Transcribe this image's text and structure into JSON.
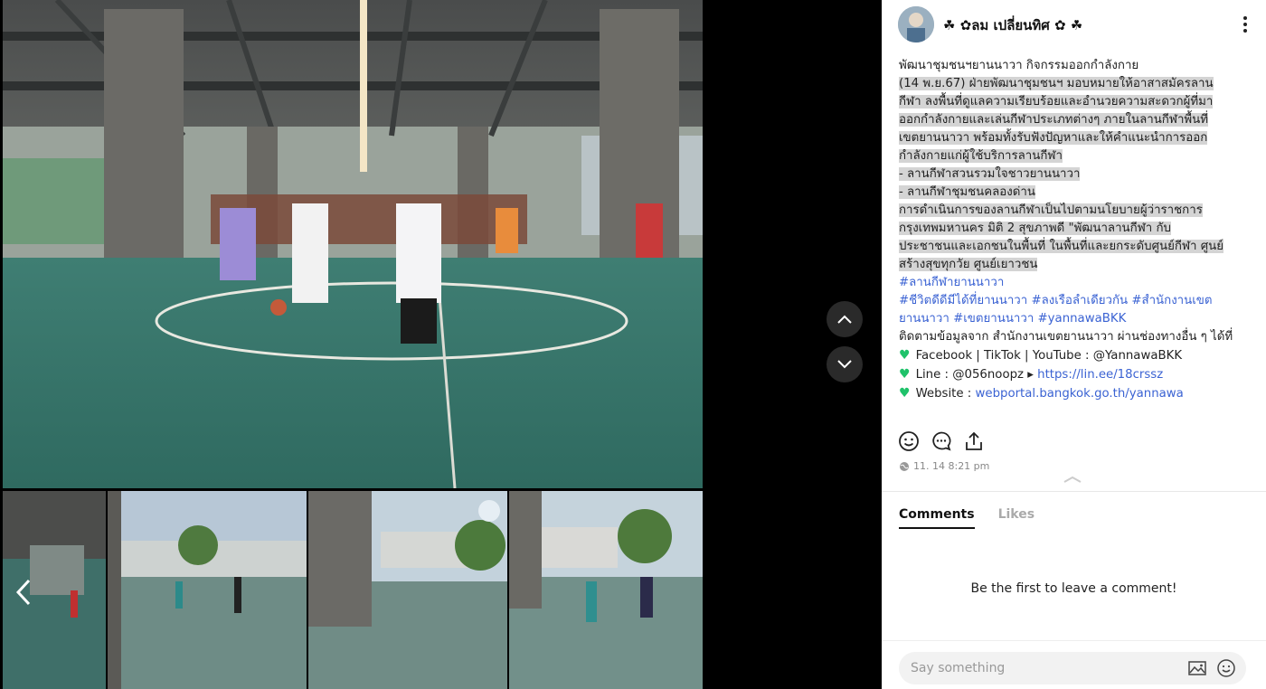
{
  "author": {
    "name": "☘ ✿ลม เปลี่ยนทิศ ✿ ☘"
  },
  "post": {
    "title": "พัฒนาชุมชนฯยานนาวา กิจกรรมออกกำลังกาย",
    "lines": [
      " (14 พ.ย.67)  ฝ่ายพัฒนาชุมชนฯ มอบหมายให้อาสาสมัครลาน",
      "กีฬา ลงพื้นที่ดูแลความเรียบร้อยและอำนวยความสะดวกผู้ที่มา",
      "ออกกำลังกายและเล่นกีฬาประเภทต่างๆ ภายในลานกีฬาพื้นที่",
      "เขตยานนาวา พร้อมทั้งรับฟังปัญหาและให้คำแนะนำการออก",
      "กำลังกายแก่ผู้ใช้บริการลานกีฬา",
      "- ลานกีฬาสวนรวมใจชาวยานนาวา",
      "- ลานกีฬาชุมชนคลองด่าน",
      "   การดำเนินการของลานกีฬาเป็นไปตามนโยบายผู้ว่าราชการ",
      "กรุงเทพมหานคร  มิติ 2 สุขภาพดี  \"พัฒนาลานกีฬา กับ",
      "ประชาชนและเอกชนในพื้นที่ ในพื้นที่และยกระดับศูนย์กีฬา ศูนย์",
      "สร้างสุขทุกวัย ศูนย์เยาวชน"
    ],
    "hashtag_1": "#ลานกีฬายานนาวา",
    "hashtag_2": "#ชีวิตดีดีมีได้ที่ยานนาวา #ลงเรือลำเดียวกัน #สำนักงานเขตยานนาวา #เขตยานนาวา #yannawaBKK",
    "follow": "ติดตามข้อมูลจาก สำนักงานเขตยานนาวา ผ่านช่องทางอื่น ๆ ได้ที่",
    "contact_1": "Facebook | TikTok | YouTube : @YannawaBKK",
    "contact_2_label": "Line : @056noopz ▸ ",
    "contact_2_link": "https://lin.ee/18crssz",
    "contact_3_label": "Website : ",
    "contact_3_link": "webportal.bangkok.go.th/yannawa",
    "timestamp": "11. 14 8:21 pm"
  },
  "tabs": {
    "comments": "Comments",
    "likes": "Likes"
  },
  "empty_comments": "Be the first to leave a comment!",
  "comment_input": {
    "placeholder": "Say something"
  },
  "colors": {
    "accent_link": "#3b63d3",
    "heart": "#1fc26a",
    "highlight": "#d4d4d4"
  }
}
